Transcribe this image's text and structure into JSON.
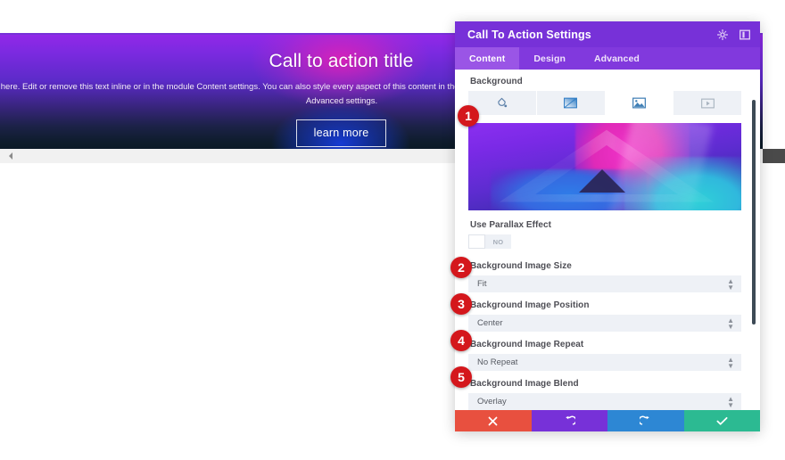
{
  "cta": {
    "title": "Call to action title",
    "body": "Your content goes here. Edit or remove this text inline or in the module Content settings. You can also style every aspect of this content in the module Design settings and even apply custom CSS to this text in the module Advanced settings.",
    "button_label": "learn more",
    "collapse_handle_icon": "chevron-left-icon"
  },
  "panel": {
    "title": "Call To Action Settings",
    "header_icons": [
      {
        "name": "move-icon",
        "glyph": "✤"
      },
      {
        "name": "layout-toggle-icon",
        "glyph": "▣"
      }
    ],
    "tabs": [
      {
        "label": "Content",
        "active": true
      },
      {
        "label": "Design",
        "active": false
      },
      {
        "label": "Advanced",
        "active": false
      }
    ],
    "background": {
      "section_label": "Background",
      "types": [
        {
          "name": "background-color-tab",
          "icon": "color-drop-icon",
          "active": false
        },
        {
          "name": "background-gradient-tab",
          "icon": "gradient-icon",
          "active": false
        },
        {
          "name": "background-image-tab",
          "icon": "image-icon",
          "active": true
        },
        {
          "name": "background-video-tab",
          "icon": "video-icon",
          "active": false
        }
      ],
      "image_preview_alt": "abstract purple magenta blue triangular gradient"
    },
    "parallax": {
      "label": "Use Parallax Effect",
      "value": "NO"
    },
    "fields": [
      {
        "badge": "2",
        "label": "Background Image Size",
        "value": "Fit"
      },
      {
        "badge": "3",
        "label": "Background Image Position",
        "value": "Center"
      },
      {
        "badge": "4",
        "label": "Background Image Repeat",
        "value": "No Repeat"
      },
      {
        "badge": "5",
        "label": "Background Image Blend",
        "value": "Overlay"
      }
    ],
    "image_badge": "1",
    "footer": [
      {
        "name": "cancel-button",
        "icon": "close-icon",
        "color": "#e8503f"
      },
      {
        "name": "undo-button",
        "icon": "undo-icon",
        "color": "#7731d8"
      },
      {
        "name": "redo-button",
        "icon": "redo-icon",
        "color": "#2d87d4"
      },
      {
        "name": "save-button",
        "icon": "check-icon",
        "color": "#2cba92"
      }
    ]
  },
  "colors": {
    "panel_header": "#7731d8",
    "tab_bar": "#8139dd",
    "tab_active": "#9a55e6",
    "badge_red": "#d4171c",
    "field_bg": "#eef1f6"
  }
}
